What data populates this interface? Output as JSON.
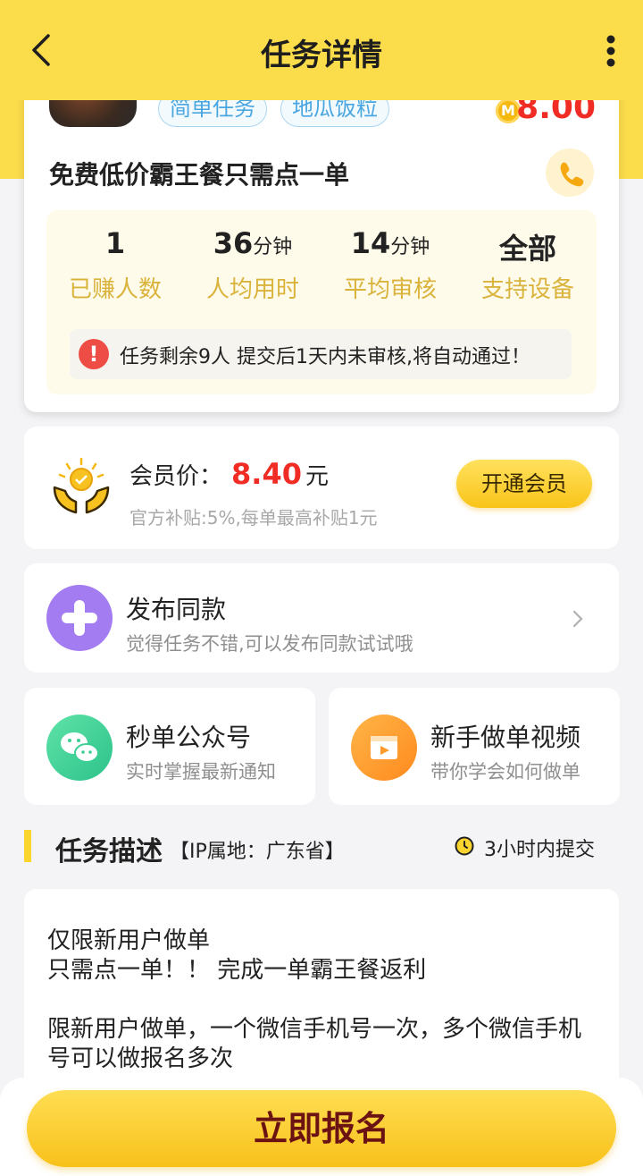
{
  "header": {
    "title": "任务详情",
    "back_icon": "chevron-left-icon",
    "more_icon": "more-vertical-icon"
  },
  "task": {
    "tags": [
      "简单任务",
      "地瓜饭粒"
    ],
    "coin_glyph": "M",
    "reward": "8.00",
    "name": "免费低价霸王餐只需点一单",
    "stats": [
      {
        "value": "1",
        "unit": "",
        "label": "已赚人数"
      },
      {
        "value": "36",
        "unit": "分钟",
        "label": "人均用时"
      },
      {
        "value": "14",
        "unit": "分钟",
        "label": "平均审核"
      },
      {
        "value": "全部",
        "unit": "",
        "label": "支持设备"
      }
    ],
    "notice": "任务剩余9人  提交后1天内未审核,将自动通过！"
  },
  "member": {
    "label": "会员价：",
    "price": "8.40",
    "unit": "元",
    "sub": "官方补贴:5%,每单最高补贴1元",
    "button": "开通会员"
  },
  "publish": {
    "title": "发布同款",
    "sub": "觉得任务不错,可以发布同款试试哦"
  },
  "mini_cards": [
    {
      "title": "秒单公众号",
      "sub": "实时掌握最新通知",
      "icon": "wechat-icon"
    },
    {
      "title": "新手做单视频",
      "sub": "带你学会如何做单",
      "icon": "video-icon"
    }
  ],
  "section": {
    "title": "任务描述",
    "ip": "【IP属地：广东省】",
    "time": "3小时内提交"
  },
  "description": "仅限新用户做单\n只需点一单！！ 完成一单霸王餐返利\n\n限新用户做单，一个微信手机号一次，多个微信手机号可以做报名多次",
  "bottom": {
    "button": "立即报名"
  },
  "colors": {
    "brand_yellow": "#fbdc4a",
    "price_red": "#f02c24",
    "stat_label": "#d9b33c"
  }
}
